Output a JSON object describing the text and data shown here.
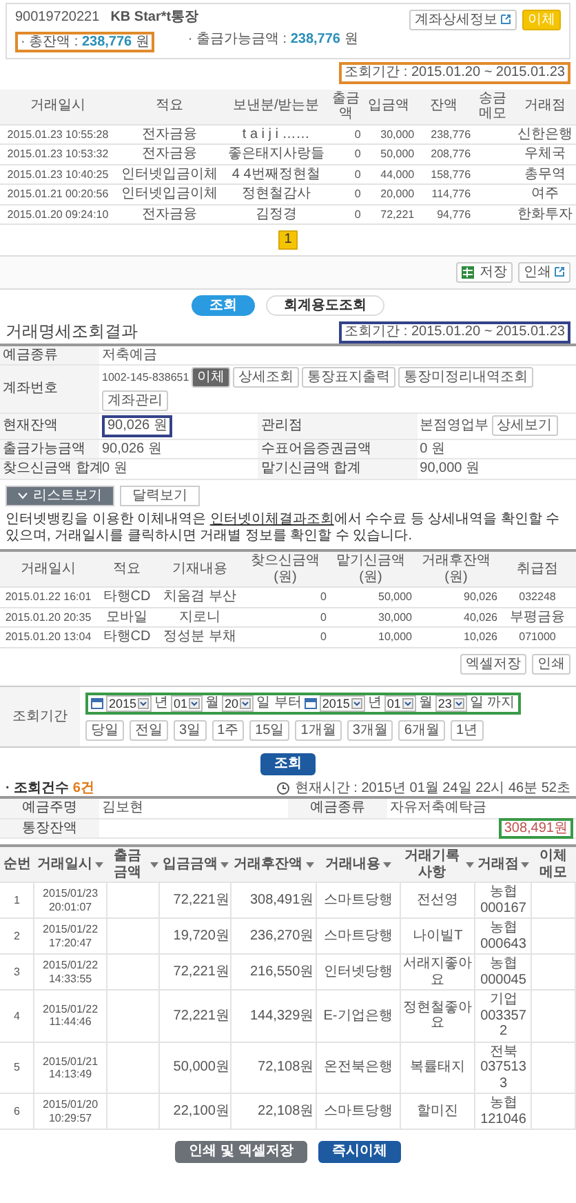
{
  "account_card": {
    "number": "90019720221",
    "name": "KB Star*t통장",
    "balance_label": "· 총잔액 : ",
    "balance": "238,776",
    "balance_unit": "원",
    "available_label": "· 출금가능금액 : ",
    "available": "238,776",
    "available_unit": "원",
    "buttons": [
      "계좌상세정보",
      "이체"
    ]
  },
  "history": {
    "period": "조회기간 : 2015.01.20 ~ 2015.01.23",
    "columns": [
      "거래일시",
      "적요",
      "보낸분/받는분",
      "출금액",
      "입금액",
      "잔액",
      "송금메모",
      "거래점"
    ],
    "rows": [
      {
        "date": "2015.01.23 10:55:28",
        "summary": "전자금융",
        "party": "t a i j i ……",
        "withdrawal": "0",
        "deposit": "30,000",
        "balance": "238,776",
        "branch": "신한은행"
      },
      {
        "date": "2015.01.23 10:53:32",
        "summary": "전자금융",
        "party": "좋은태지사랑들",
        "withdrawal": "0",
        "deposit": "50,000",
        "balance": "208,776",
        "branch": "우체국"
      },
      {
        "date": "2015.01.23 10:40:25",
        "summary": "인터넷입금이체",
        "party": "4 4번째정현철",
        "withdrawal": "0",
        "deposit": "44,000",
        "balance": "158,776",
        "branch": "총무역"
      },
      {
        "date": "2015.01.21 00:20:56",
        "summary": "인터넷입금이체",
        "party": "정현철감사",
        "withdrawal": "0",
        "deposit": "20,000",
        "balance": "114,776",
        "branch": "여주"
      },
      {
        "date": "2015.01.20 09:24:10",
        "summary": "전자금융",
        "party": "김정경",
        "withdrawal": "0",
        "deposit": "72,221",
        "balance": "94,776",
        "branch": "한화투자"
      }
    ],
    "pages": [
      {
        "label": "1",
        "selected": true
      }
    ],
    "tools": [
      "저장",
      "인쇄"
    ],
    "actions": [
      {
        "label": "조회",
        "kind": "primary"
      },
      {
        "label": "회계용도조회",
        "kind": "secondary"
      }
    ]
  },
  "statement": {
    "title": "거래명세조회결과",
    "period": "조회기간 : 2015.01.20 ~ 2015.01.23",
    "info": [
      [
        {
          "label": "예금종류",
          "value": "저축예금"
        }
      ],
      [
        {
          "label": "계좌번호",
          "value": "1002-145-838651",
          "buttons": [
            "이체",
            "상세조회",
            "통장표지출력",
            "통장미정리내역조회",
            "계좌관리"
          ]
        }
      ],
      [
        {
          "label": "현재잔액",
          "value": "90,026 원",
          "highlighted": true
        },
        {
          "label": "관리점",
          "value": "본점영업부",
          "buttons": [
            "상세보기"
          ]
        }
      ],
      [
        {
          "label": "출금가능금액",
          "value": "90,026 원"
        },
        {
          "label": "수표어음증권금액",
          "value": "0 원"
        }
      ],
      [
        {
          "label": "찾으신금액 합계",
          "value": "0 원"
        },
        {
          "label": "맡기신금액 합계",
          "value": "90,000 원"
        }
      ]
    ],
    "tabs": [
      {
        "label": "리스트보기",
        "selected": true
      },
      {
        "label": "달력보기",
        "selected": false
      }
    ],
    "notice": {
      "before": "인터넷뱅킹을 이용한 이체내역은 ",
      "link": "인터넷이체결과조회",
      "after": "에서 수수료 등 상세내역을 확인할 수 있으며, 거래일시를 클릭하시면 거래별 정보를 확인할 수 있습니다."
    },
    "columns": [
      "거래일시",
      "적요",
      "기재내용",
      "찾으신금액(원)",
      "맡기신금액(원)",
      "거래후잔액(원)",
      "취급점"
    ],
    "rows": [
      [
        "2015.01.22 16:01",
        "타행CD",
        "치움겸 부산",
        "0",
        "50,000",
        "90,026",
        "032248"
      ],
      [
        "2015.01.20 20:35",
        "모바일",
        "지로니",
        "0",
        "30,000",
        "40,026",
        "부평금융"
      ],
      [
        "2015.01.20 13:04",
        "타행CD",
        "정성분 부채",
        "0",
        "10,000",
        "10,026",
        "071000"
      ]
    ],
    "tools": [
      "엑셀저장",
      "인쇄"
    ]
  },
  "search_form": {
    "label": "조회기간",
    "from": [
      {
        "value": "2015",
        "unit": "년"
      },
      {
        "value": "01",
        "unit": "월"
      },
      {
        "value": "20",
        "unit": "일 부터"
      }
    ],
    "to": [
      {
        "value": "2015",
        "unit": "년"
      },
      {
        "value": "01",
        "unit": "월"
      },
      {
        "value": "23",
        "unit": "일 까지"
      }
    ],
    "quick": [
      "당일",
      "전일",
      "3일",
      "1주",
      "15일",
      "1개월",
      "3개월",
      "6개월",
      "1년"
    ],
    "submit": "조회"
  },
  "result": {
    "count_label": "· 조회건수 ",
    "count": "6건",
    "time": "현재시간 : 2015년 01월 24일 22시 46분 52초",
    "info": [
      [
        {
          "label": "예금주명",
          "value": "김보현"
        },
        {
          "label": "예금종류",
          "value": "자유저축예탁금"
        }
      ],
      [
        {
          "label": "통장잔액",
          "value": "308,491원",
          "highlighted": true
        }
      ]
    ],
    "columns": [
      {
        "label": "순번",
        "sortable": false
      },
      {
        "label": "거래일시",
        "sortable": true
      },
      {
        "label": "출금금액",
        "sortable": true
      },
      {
        "label": "입금금액",
        "sortable": true
      },
      {
        "label": "거래후잔액",
        "sortable": true
      },
      {
        "label": "거래내용",
        "sortable": true
      },
      {
        "label": "거래기록사항",
        "sortable": true
      },
      {
        "label": "거래점",
        "sortable": true
      },
      {
        "label": "이체메모",
        "sortable": false
      }
    ],
    "rows": [
      [
        "1",
        "2015/01/23 20:01:07",
        "",
        "72,221원",
        "308,491원",
        "스마트당행",
        "전선영",
        "농협 000167",
        ""
      ],
      [
        "2",
        "2015/01/22 17:20:47",
        "",
        "19,720원",
        "236,270원",
        "스마트당행",
        "나이빌T",
        "농협 000643",
        ""
      ],
      [
        "3",
        "2015/01/22 14:33:55",
        "",
        "72,221원",
        "216,550원",
        "인터넷당행",
        "서래지좋아요",
        "농협 000045",
        ""
      ],
      [
        "4",
        "2015/01/22 11:44:46",
        "",
        "72,221원",
        "144,329원",
        "E-기업은행",
        "정현철좋아요",
        "기업 0033572",
        ""
      ],
      [
        "5",
        "2015/01/21 14:13:49",
        "",
        "50,000원",
        "72,108원",
        "온전북은행",
        "복률태지",
        "전북 0375133",
        ""
      ],
      [
        "6",
        "2015/01/20 10:29:57",
        "",
        "22,100원",
        "22,108원",
        "스마트당행",
        "할미진",
        "농협 121046",
        ""
      ]
    ],
    "buttons": [
      {
        "label": "인쇄 및 엑셀저장",
        "kind": "secondary"
      },
      {
        "label": "즉시이체",
        "kind": "primary"
      }
    ]
  }
}
